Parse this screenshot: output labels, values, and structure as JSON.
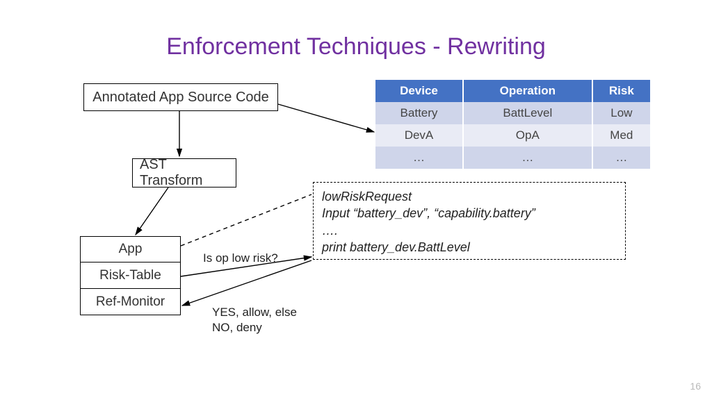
{
  "title": "Enforcement Techniques - Rewriting",
  "boxes": {
    "source": "Annotated App Source Code",
    "ast": "AST Transform",
    "app": "App",
    "risk": "Risk-Table",
    "ref": "Ref-Monitor"
  },
  "table": {
    "headers": [
      "Device",
      "Operation",
      "Risk"
    ],
    "rows": [
      [
        "Battery",
        "BattLevel",
        "Low"
      ],
      [
        "DevA",
        "OpA",
        "Med"
      ],
      [
        "…",
        "…",
        "…"
      ]
    ]
  },
  "code": {
    "line1": "lowRiskRequest",
    "line2": "Input “battery_dev”, “capability.battery”",
    "line3": "….",
    "line4": "print  battery_dev.BattLevel"
  },
  "labels": {
    "question": "Is op low risk?",
    "yes": "YES, allow, else",
    "no": "NO, deny"
  },
  "pagenum": "16"
}
